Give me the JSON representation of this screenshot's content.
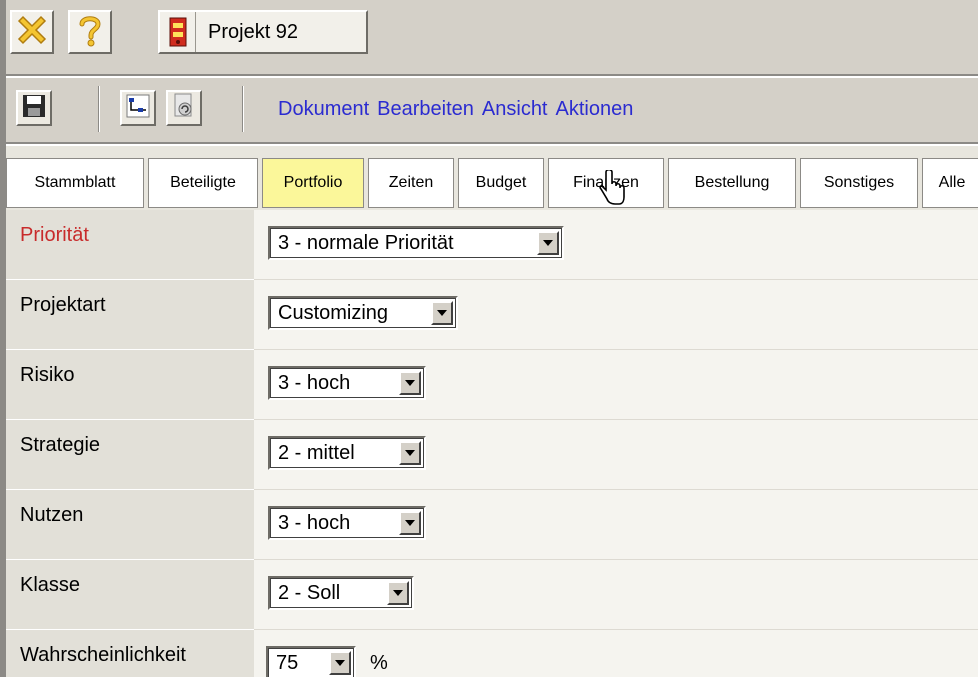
{
  "titlebar": {
    "close_icon": "close-x-icon",
    "help_icon": "question-icon",
    "document_icon": "binder-icon",
    "document_title": "Projekt 92"
  },
  "toolbar": {
    "save_icon": "floppy-disk-icon",
    "tree_icon": "hierarchy-icon",
    "refresh_icon": "document-refresh-icon",
    "menu": [
      "Dokument",
      "Bearbeiten",
      "Ansicht",
      "Aktionen"
    ]
  },
  "tabs": [
    {
      "label": "Stammblatt",
      "active": false
    },
    {
      "label": "Beteiligte",
      "active": false
    },
    {
      "label": "Portfolio",
      "active": true
    },
    {
      "label": "Zeiten",
      "active": false
    },
    {
      "label": "Budget",
      "active": false
    },
    {
      "label": "Finanzen",
      "active": false
    },
    {
      "label": "Bestellung",
      "active": false
    },
    {
      "label": "Sonstiges",
      "active": false
    },
    {
      "label": "Alle",
      "active": false
    }
  ],
  "form": {
    "fields": [
      {
        "label": "Priorität",
        "value": "3 - normale Priorität",
        "required": true
      },
      {
        "label": "Projektart",
        "value": "Customizing"
      },
      {
        "label": "Risiko",
        "value": "3 - hoch"
      },
      {
        "label": "Strategie",
        "value": "2 - mittel"
      },
      {
        "label": "Nutzen",
        "value": "3 - hoch"
      },
      {
        "label": "Klasse",
        "value": "2 - Soll"
      },
      {
        "label": "Wahrscheinlichkeit",
        "value": "75",
        "unit": "%"
      }
    ]
  },
  "colors": {
    "menu_link": "#2b2bd0",
    "required_label": "#c82b2b",
    "active_tab": "#fbf79a",
    "chrome": "#d4d0c8"
  }
}
